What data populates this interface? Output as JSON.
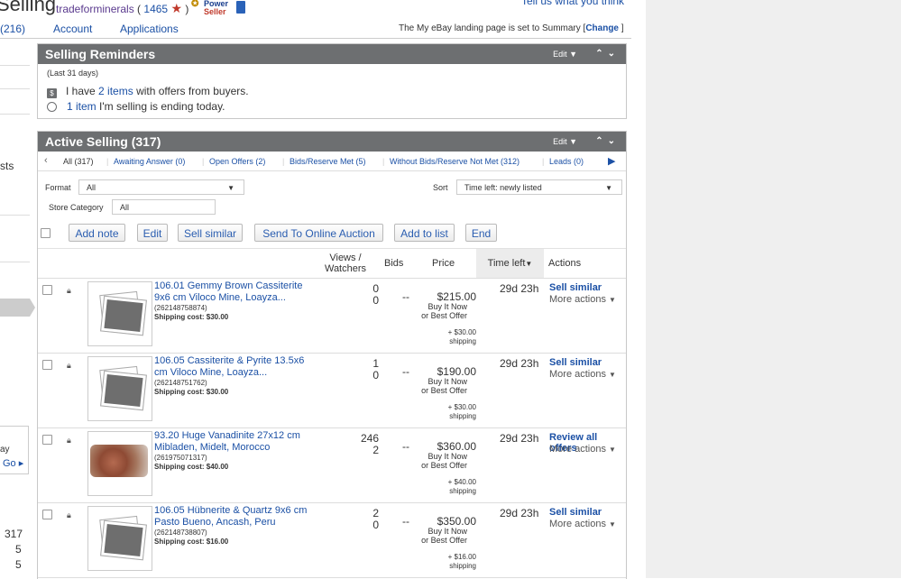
{
  "header": {
    "title": "Selling",
    "seller_name": "tradeforminerals",
    "feedback_score": "1465",
    "power_line1": "Power",
    "power_line2": "Seller",
    "tell_us": "Tell us what you think"
  },
  "tabs": {
    "count": "(216)",
    "account": "Account",
    "applications": "Applications",
    "landing_text": "The My eBay landing page is set to Summary",
    "landing_change": "Change"
  },
  "left_col": {
    "partial1": "sts",
    "partial2": "ay",
    "go": "Go ▸",
    "num1": "317",
    "num2": "5",
    "num3": "5"
  },
  "reminders": {
    "title": "Selling Reminders",
    "edit": "Edit ▼",
    "period": "(Last 31 days)",
    "line1_pre": "I have",
    "line1_link": "2 items",
    "line1_post": "with offers from buyers.",
    "line2_link": "1 item",
    "line2_post": "I'm selling is ending today."
  },
  "active": {
    "title": "Active Selling (317)",
    "edit": "Edit ▼",
    "filters": [
      "All (317)",
      "Awaiting Answer (0)",
      "Open Offers (2)",
      "Bids/Reserve Met (5)",
      "Without Bids/Reserve Not Met (312)",
      "Leads (0)"
    ],
    "format_label": "Format",
    "format_value": "All",
    "sort_label": "Sort",
    "sort_value": "Time left: newly listed",
    "store_label": "Store Category",
    "store_value": "All",
    "buttons": [
      "Add note",
      "Edit",
      "Sell similar",
      "Send To Online Auction",
      "Add to list",
      "End"
    ],
    "columns": {
      "views_line1": "Views /",
      "views_line2": "Watchers",
      "bids": "Bids",
      "price": "Price",
      "time_left": "Time left",
      "actions": "Actions"
    }
  },
  "items": [
    {
      "title": "106.01 Gemmy Brown Cassiterite 9x6 cm Viloco Mine, Loayza...",
      "id": "(262148758874)",
      "shipping": "Shipping cost: $30.00",
      "views": "0",
      "watchers": "0",
      "bids": "--",
      "price": "$215.00",
      "bin1": "Buy It Now",
      "bin2": "or Best Offer",
      "ship_amt": "+ $30.00",
      "ship_lbl": "shipping",
      "time_left": "29d 23h",
      "action": "Sell similar",
      "more": "More actions",
      "photo": "placeholder"
    },
    {
      "title": "106.05 Cassiterite & Pyrite 13.5x6 cm Viloco Mine, Loayza...",
      "id": "(262148751762)",
      "shipping": "Shipping cost: $30.00",
      "views": "1",
      "watchers": "0",
      "bids": "--",
      "price": "$190.00",
      "bin1": "Buy It Now",
      "bin2": "or Best Offer",
      "ship_amt": "+ $30.00",
      "ship_lbl": "shipping",
      "time_left": "29d 23h",
      "action": "Sell similar",
      "more": "More actions",
      "photo": "placeholder"
    },
    {
      "title": "93.20 Huge Vanadinite 27x12 cm Mibladen, Midelt, Morocco",
      "id": "(261975071317)",
      "shipping": "Shipping cost: $40.00",
      "views": "246",
      "watchers": "2",
      "bids": "--",
      "price": "$360.00",
      "bin1": "Buy It Now",
      "bin2": "or Best Offer",
      "ship_amt": "+ $40.00",
      "ship_lbl": "shipping",
      "time_left": "29d 23h",
      "action": "Review all offers",
      "more": "More actions",
      "photo": "mineral"
    },
    {
      "title": "106.05 Hübnerite & Quartz 9x6 cm Pasto Bueno, Ancash, Peru",
      "id": "(262148738807)",
      "shipping": "Shipping cost: $16.00",
      "views": "2",
      "watchers": "0",
      "bids": "--",
      "price": "$350.00",
      "bin1": "Buy It Now",
      "bin2": "or Best Offer",
      "ship_amt": "+ $16.00",
      "ship_lbl": "shipping",
      "time_left": "29d 23h",
      "action": "Sell similar",
      "more": "More actions",
      "photo": "placeholder"
    }
  ]
}
